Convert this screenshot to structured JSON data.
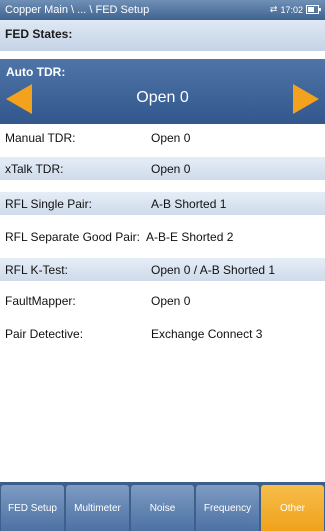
{
  "titlebar": {
    "path": "Copper Main \\ ... \\ FED Setup",
    "time": "17:02",
    "signal_icon": "transfer-arrows-icon",
    "battery_icon": "battery-icon"
  },
  "fed_states": {
    "label": "FED States:"
  },
  "auto_tdr": {
    "label": "Auto TDR:",
    "value": "Open 0"
  },
  "rows": [
    {
      "label": "Manual TDR:",
      "value": "Open 0"
    },
    {
      "label": "xTalk TDR:",
      "value": "Open 0"
    },
    {
      "label": "RFL Single Pair:",
      "value": "A-B Shorted 1"
    },
    {
      "label": "RFL Separate Good Pair:",
      "value": "A-B-E Shorted 2"
    },
    {
      "label": "RFL K-Test:",
      "value": "Open 0 / A-B Shorted 1"
    },
    {
      "label": "FaultMapper:",
      "value": "Open 0"
    },
    {
      "label": "Pair Detective:",
      "value": "Exchange Connect 3"
    }
  ],
  "tabs": [
    {
      "label": "FED Setup"
    },
    {
      "label": "Multimeter"
    },
    {
      "label": "Noise"
    },
    {
      "label": "Frequency"
    },
    {
      "label": "Other"
    }
  ],
  "colors": {
    "accent": "#f2a21c",
    "header_blue": "#3f638f"
  }
}
